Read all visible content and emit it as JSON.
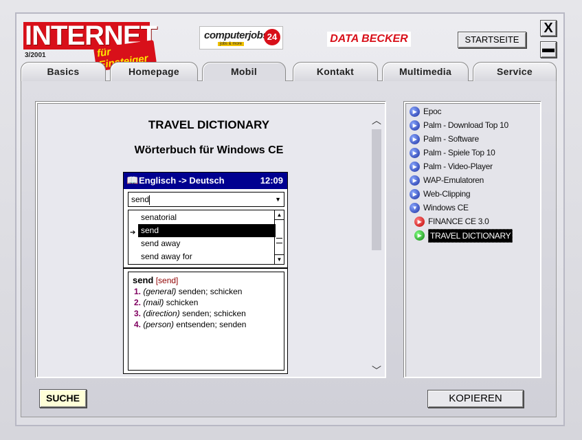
{
  "header": {
    "logo_main": "INTERNET",
    "logo_sub": "für Einsteiger",
    "issue": "3/2001",
    "cj_text": "computerjobs",
    "cj_number": "24",
    "cj_small": "jobs & more",
    "db_logo": "DATA BECKER",
    "start_label": "STARTSEITE",
    "close_label": "X",
    "min_label": "▬"
  },
  "tabs": [
    {
      "label": "Basics"
    },
    {
      "label": "Homepage"
    },
    {
      "label": "Mobil",
      "active": true
    },
    {
      "label": "Kontakt"
    },
    {
      "label": "Multimedia"
    },
    {
      "label": "Service"
    }
  ],
  "main": {
    "title": "TRAVEL DICTIONARY",
    "subtitle": "Wörterbuch für Windows CE"
  },
  "pda": {
    "icon": "book-icon",
    "title": "Englisch -> Deutsch",
    "time": "12:09",
    "input_value": "send",
    "list": [
      "senatorial",
      "send",
      "send away",
      "send away for"
    ],
    "selected_index": 1,
    "definition": {
      "headword": "send",
      "phonetic": "[send]",
      "senses": [
        {
          "num": "1.",
          "tag": "(general)",
          "text": "senden; schicken"
        },
        {
          "num": "2.",
          "tag": "(mail)",
          "text": "schicken"
        },
        {
          "num": "3.",
          "tag": "(direction)",
          "text": "senden; schicken"
        },
        {
          "num": "4.",
          "tag": "(person)",
          "text": "entsenden; senden"
        }
      ]
    }
  },
  "tree": [
    {
      "label": "Epoc",
      "color": "blue",
      "level": 0
    },
    {
      "label": "Palm - Download Top 10",
      "color": "blue",
      "level": 0
    },
    {
      "label": "Palm - Software",
      "color": "blue",
      "level": 0
    },
    {
      "label": "Palm - Spiele Top 10",
      "color": "blue",
      "level": 0
    },
    {
      "label": "Palm - Video-Player",
      "color": "blue",
      "level": 0
    },
    {
      "label": "WAP-Emulatoren",
      "color": "blue",
      "level": 0
    },
    {
      "label": "Web-Clipping",
      "color": "blue",
      "level": 0
    },
    {
      "label": "Windows CE",
      "color": "blue",
      "level": 0,
      "expanded": true
    },
    {
      "label": "FINANCE CE 3.0",
      "color": "red",
      "level": 1
    },
    {
      "label": "TRAVEL DICTIONARY",
      "color": "green",
      "level": 1,
      "selected": true
    }
  ],
  "footer": {
    "search_label": "SUCHE",
    "copy_label": "KOPIEREN"
  }
}
